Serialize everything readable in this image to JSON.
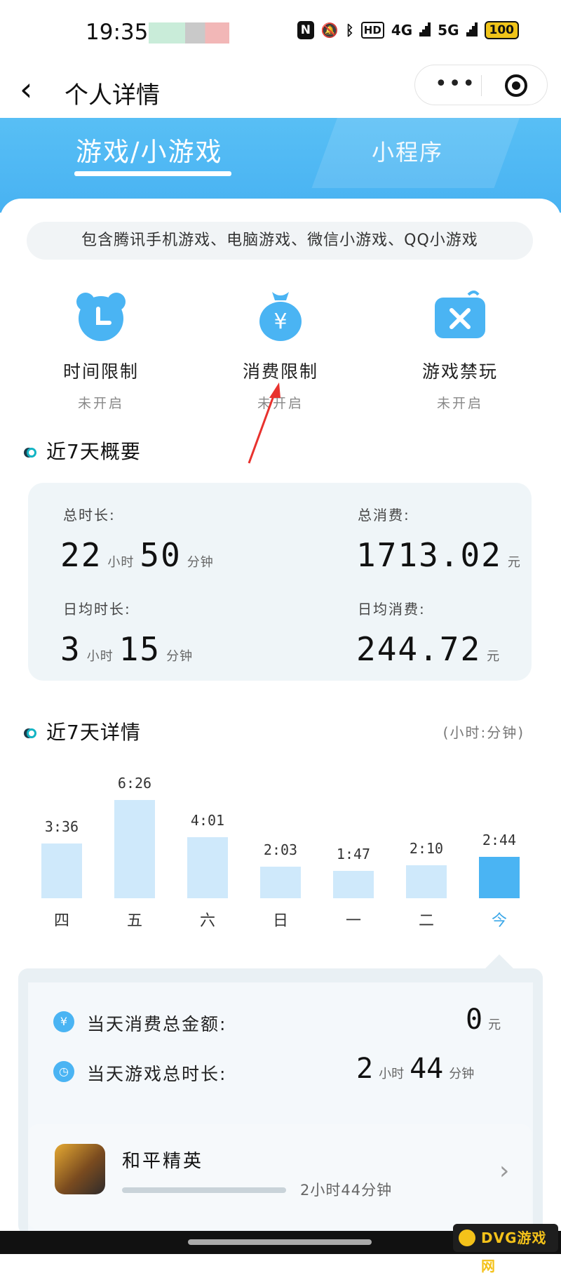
{
  "status": {
    "time": "19:35",
    "hd": "HD",
    "net1": "4G",
    "net2": "5G",
    "battery": "100"
  },
  "nav": {
    "back": "‹",
    "title": "个人详情"
  },
  "tabs": [
    {
      "label": "游戏/小游戏"
    },
    {
      "label": "小程序"
    }
  ],
  "note": "包含腾讯手机游戏、电脑游戏、微信小游戏、QQ小游戏",
  "controls": [
    {
      "label": "时间限制",
      "status": "未开启",
      "icon": "clock-icon"
    },
    {
      "label": "消费限制",
      "status": "未开启",
      "icon": "money-bag-icon"
    },
    {
      "label": "游戏禁玩",
      "status": "未开启",
      "icon": "ban-icon"
    }
  ],
  "summary": {
    "title": "近7天概要",
    "total_time_label": "总时长:",
    "total_time_h": "22",
    "total_time_m": "50",
    "total_spend_label": "总消费:",
    "total_spend": "1713.02",
    "avg_time_label": "日均时长:",
    "avg_time_h": "3",
    "avg_time_m": "15",
    "avg_spend_label": "日均消费:",
    "avg_spend": "244.72",
    "hour_unit": "小时",
    "minute_unit": "分钟",
    "yuan": "元"
  },
  "details_title": "近7天详情",
  "details_unit_note": "(小时:分钟)",
  "chart_data": {
    "type": "bar",
    "categories": [
      "四",
      "五",
      "六",
      "日",
      "一",
      "二",
      "今"
    ],
    "values": [
      216,
      386,
      241,
      123,
      107,
      130,
      164
    ],
    "labels": [
      "3:36",
      "6:26",
      "4:01",
      "2:03",
      "1:47",
      "2:10",
      "2:44"
    ],
    "highlight_index": 6,
    "colors": {
      "bar": "#cfe9fb",
      "highlight": "#4ab4f3"
    }
  },
  "today": {
    "spend_label": "当天消费总金额:",
    "spend_value": "0",
    "time_label": "当天游戏总时长:",
    "time_h": "2",
    "time_m": "44"
  },
  "game": {
    "name": "和平精英",
    "time": "2小时44分钟"
  },
  "watermark": "DVG游戏网"
}
